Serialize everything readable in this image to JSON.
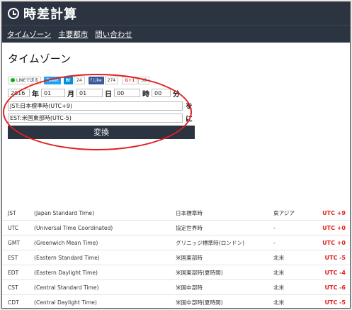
{
  "header": {
    "title": "時差計算"
  },
  "nav": {
    "items": [
      "タイムゾーン",
      "主要都市",
      "問い合わせ"
    ]
  },
  "page_title": "タイムゾーン",
  "share": {
    "line_label": "LINEで送る",
    "tweet_label": "Tweet",
    "hatena_label": "B!",
    "hatena_count": "24",
    "fb_label": "f Like",
    "fb_count": "274",
    "gplus_label": "G+1",
    "gplus_count": "58"
  },
  "form": {
    "year": "2016",
    "year_unit": "年",
    "month": "01",
    "month_unit": "月",
    "day": "01",
    "day_unit": "日",
    "hour": "00",
    "hour_unit": "時",
    "minute": "00",
    "minute_unit": "分",
    "from_zone": "JST:日本標準時(UTC+9)",
    "from_suffix": "を",
    "to_zone": "EST:米国東部時(UTC-5)",
    "to_suffix": "に",
    "convert_label": "変換"
  },
  "timezones": [
    {
      "abbr": "JST",
      "name": "(Japan Standard Time)",
      "ja": "日本標準時",
      "region": "東アジア",
      "offset": "UTC +9"
    },
    {
      "abbr": "UTC",
      "name": "(Universal Time Coordinated)",
      "ja": "協定世界時",
      "region": "-",
      "offset": "UTC +0"
    },
    {
      "abbr": "GMT",
      "name": "(Greenwich Mean Time)",
      "ja": "グリニッジ標準時(ロンドン)",
      "region": "-",
      "offset": "UTC +0"
    },
    {
      "abbr": "EST",
      "name": "(Eastern Standard Time)",
      "ja": "米国東部時",
      "region": "北米",
      "offset": "UTC -5"
    },
    {
      "abbr": "EDT",
      "name": "(Eastern Daylight Time)",
      "ja": "米国東部時(夏時間)",
      "region": "北米",
      "offset": "UTC -4"
    },
    {
      "abbr": "CST",
      "name": "(Central Standard Time)",
      "ja": "米国中部時",
      "region": "北米",
      "offset": "UTC -6"
    },
    {
      "abbr": "CDT",
      "name": "(Central Daylight Time)",
      "ja": "米国中部時(夏時間)",
      "region": "北米",
      "offset": "UTC -5"
    }
  ],
  "colors": {
    "header_bg": "#2b3440",
    "annotation": "#e02020",
    "offset_text": "#e02020"
  }
}
